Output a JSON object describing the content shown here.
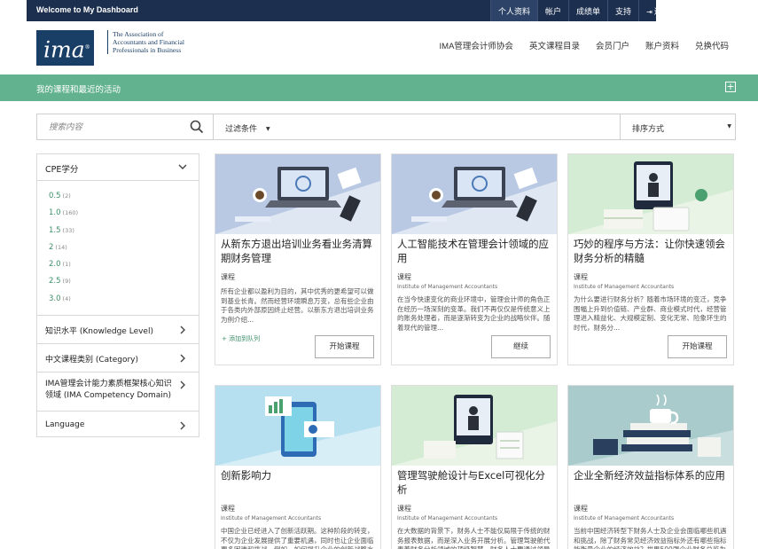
{
  "topbar": {
    "title": "Welcome to My Dashboard",
    "nav": [
      {
        "label": "个人资料",
        "name": "topnav-profile"
      },
      {
        "label": "帐户",
        "name": "topnav-account"
      },
      {
        "label": "成绩单",
        "name": "topnav-transcript"
      },
      {
        "label": "支持",
        "name": "topnav-support"
      },
      {
        "label": "退出",
        "name": "topnav-logout"
      }
    ]
  },
  "header": {
    "logo_text": "ima",
    "logo_tagline": "The Association of Accountants and Financial Professionals in Business",
    "nav": [
      {
        "label": "IMA管理会计师协会",
        "name": "nav-ima"
      },
      {
        "label": "英文课程目录",
        "name": "nav-english-catalog"
      },
      {
        "label": "会员门户",
        "name": "nav-member-portal"
      },
      {
        "label": "账户资料",
        "name": "nav-account-info"
      },
      {
        "label": "兑换代码",
        "name": "nav-redeem-code"
      }
    ]
  },
  "greenbar": {
    "title": "我的课程和最近的活动"
  },
  "filters": {
    "search_placeholder": "搜索内容",
    "condition_label": "过滤条件",
    "sort_label": "排序方式"
  },
  "sidebar": {
    "cpe_title": "CPE学分",
    "cpe_items": [
      {
        "value": "0.5",
        "count": "(2)"
      },
      {
        "value": "1.0",
        "count": "(160)"
      },
      {
        "value": "1.5",
        "count": "(33)"
      },
      {
        "value": "2",
        "count": "(14)"
      },
      {
        "value": "2.0",
        "count": "(1)"
      },
      {
        "value": "2.5",
        "count": "(9)"
      },
      {
        "value": "3.0",
        "count": "(4)"
      }
    ],
    "sections": [
      {
        "label": "知识水平 (Knowledge Level)"
      },
      {
        "label": "中文课程类别 (Category)"
      },
      {
        "label": "IMA管理会计能力素质框架核心知识领域 (IMA Competency Domain)"
      },
      {
        "label": "Language"
      }
    ]
  },
  "cards": [
    {
      "title": "从新东方退出培训业务看业务清算期财务管理",
      "type": "课程",
      "org": "",
      "desc": "所有企业都以盈利为目的，其中优秀的更希望可以做到基业长青。然而经营环境瞬息万变，总有些企业由于各类内外部原因终止经营。以新东方退出培训业务为例介绍...",
      "add_label": "+ 添加到队列",
      "button": "开始课程"
    },
    {
      "title": "人工智能技术在管理会计领域的应用",
      "type": "课程",
      "org": "Institute of Management Accountants",
      "desc": "在当今快速变化的商业环境中，管理会计师的角色正在经历一场深刻的变革。我们不再仅仅是传统意义上的账务处理者，而是逐渐转变为企业的战略伙伴。随着现代的管理...",
      "add_label": "",
      "button": "继续"
    },
    {
      "title": "巧妙的程序与方法：让你快速领会财务分析的精髓",
      "type": "课程",
      "org": "Institute of Management Accountants",
      "desc": "为什么要进行财务分析？随着市场环境的变迁，竞争围幅上升到价值链、产业群、商业模式时代，经营管理进入精益化、大规模定制、变化无常、险象环生的时代，财务分...",
      "add_label": "",
      "button": "开始课程"
    },
    {
      "title": "创新影响力",
      "type": "课程",
      "org": "Institute of Management Accountants",
      "desc": "中国企业已经进入了创新活跃期。这种阶段的转变，不仅为企业发展提供了重要机遇，同时也让企业面临更多困难和挑战。例如，如何提升企业的创新战略水平？如果改善...",
      "add_label": "",
      "button": ""
    },
    {
      "title": "管理驾驶舱设计与Excel可视化分析",
      "type": "课程",
      "org": "Institute of Management Accountants",
      "desc": "在大数据的背景下，财务人士不能仅局限于传统的财务报表数据，而是深入业务开展分析。管理驾驶舱代表着财务分析领域的顶级智慧，财务人士要通过领导驾驶舱实现...",
      "add_label": "",
      "button": ""
    },
    {
      "title": "企业全新经济效益指标体系的应用",
      "type": "课程",
      "org": "Institute of Management Accountants",
      "desc": "当前中国经济转型下财务人士及企业会面临哪些机遇和挑战，除了财务常见经济效益指标外还有哪些指标能衡量企业的经济效益？世界500强企业财务总监为您深度解读...",
      "add_label": "",
      "button": ""
    }
  ]
}
